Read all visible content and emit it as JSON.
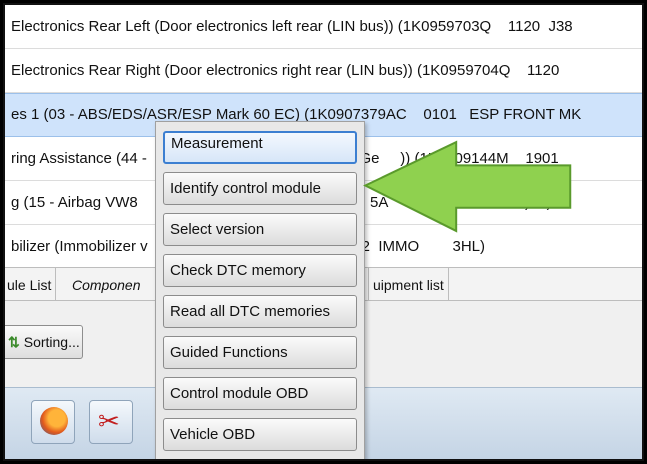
{
  "module_list": {
    "rows": [
      {
        "text": "Electronics Rear Left (Door electronics left rear (LIN bus)) (1K0959703Q    1120  J38",
        "selected": false
      },
      {
        "text": "Electronics Rear Right (Door electronics right rear (LIN bus)) (1K0959704Q    1120",
        "selected": false
      },
      {
        "text": "es 1 (03 - ABS/EDS/ASR/ESP Mark 60 EC) (1K0907379AC    0101   ESP FRONT MK",
        "selected": true
      },
      {
        "text": "ring Assistance (44 -                                          ech. (Ge     )) (1K1909144M    1901",
        "selected": false
      },
      {
        "text": "g (15 - Airbag VW8",
        "selected": false,
        "tail": "5A",
        "tail2": ")34)"
      },
      {
        "text": "bilizer (Immobilizer v                                       P    1222  IMMO        3HL)",
        "selected": false
      }
    ]
  },
  "tabs": {
    "module_list": "ule List",
    "components": "Componen",
    "equipment": "uipment list"
  },
  "toolbar": {
    "sorting_label": "Sorting..."
  },
  "context_menu": {
    "items": [
      "Measurement",
      "Identify control module",
      "Select version",
      "Check DTC memory",
      "Read all DTC memories",
      "Guided Functions",
      "Control module OBD",
      "Vehicle OBD"
    ],
    "focused_index": 0
  },
  "taskbar": {
    "icons": [
      "firefox-icon",
      "snipping-tool-icon"
    ]
  },
  "colors": {
    "selection": "#cfe3fb",
    "arrow_fill": "#8fd14f",
    "arrow_stroke": "#5a9a2c",
    "focus_border": "#3c7fd1"
  }
}
